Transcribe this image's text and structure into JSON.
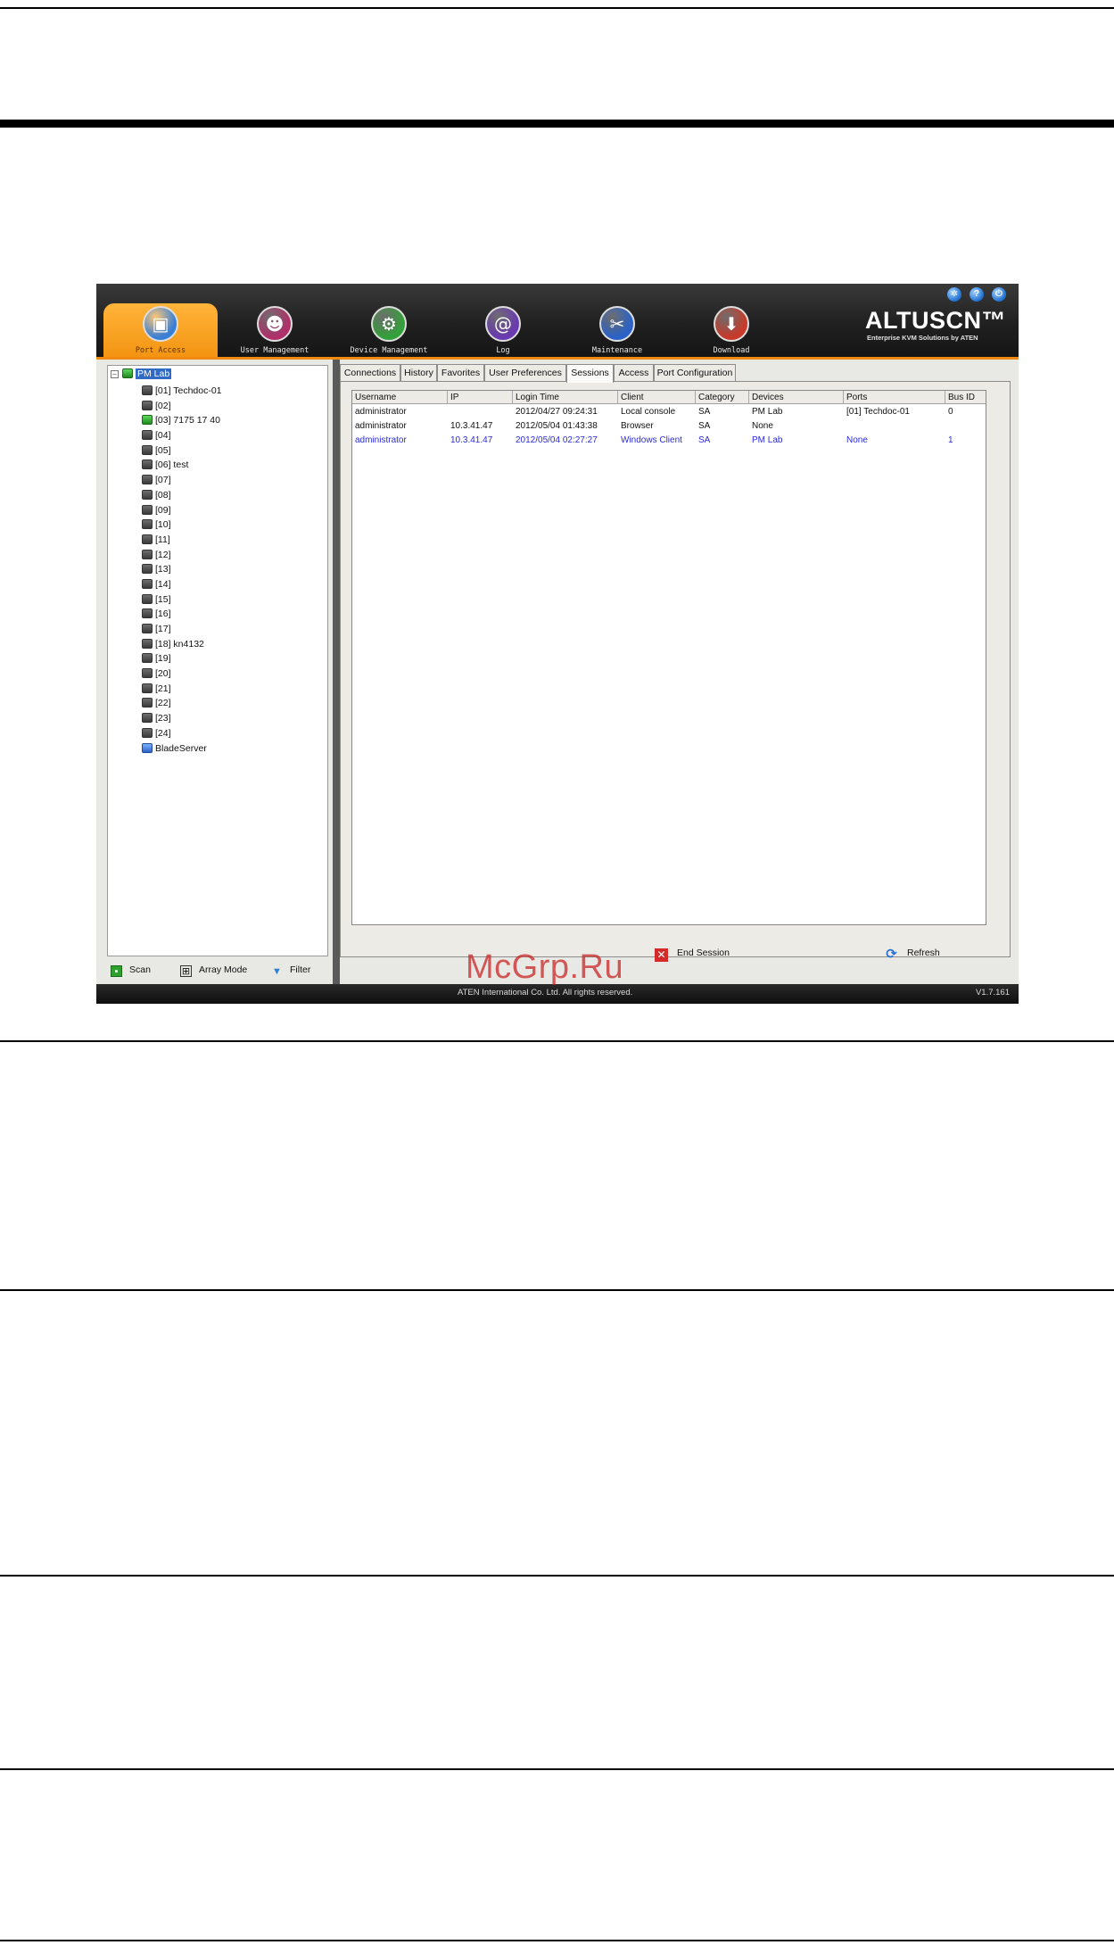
{
  "watermark": "McGrp.Ru",
  "app": {
    "window_buttons": [
      {
        "icon": "settings-icon",
        "glyph": "✲"
      },
      {
        "icon": "help-icon",
        "glyph": "?"
      },
      {
        "icon": "logout-icon",
        "glyph": "⏻"
      }
    ],
    "nav_tabs": [
      {
        "label": "Port Access",
        "icon": "port-access-icon",
        "glyph": "▣",
        "color": "#3a7fd6",
        "active": true
      },
      {
        "label": "User Management",
        "icon": "user-management-icon",
        "glyph": "☻",
        "color": "#b0306a",
        "active": false
      },
      {
        "label": "Device Management",
        "icon": "device-management-icon",
        "glyph": "⚙",
        "color": "#34a03a",
        "active": false
      },
      {
        "label": "Log",
        "icon": "log-icon",
        "glyph": "@",
        "color": "#6a3ab0",
        "active": false
      },
      {
        "label": "Maintenance",
        "icon": "maintenance-icon",
        "glyph": "✂",
        "color": "#2a62c8",
        "active": false
      },
      {
        "label": "Download",
        "icon": "download-icon",
        "glyph": "⬇",
        "color": "#c83a2a",
        "active": false
      }
    ],
    "brand": {
      "name": "ALTUSCN™",
      "tagline": "Enterprise KVM Solutions by ATEN"
    },
    "tree": {
      "root_label": "PM Lab",
      "expander": "–",
      "items": [
        {
          "label": "[01] Techdoc-01",
          "status": "offline"
        },
        {
          "label": "[02]",
          "status": "offline"
        },
        {
          "label": "[03] 7175 17 40",
          "status": "online"
        },
        {
          "label": "[04]",
          "status": "offline"
        },
        {
          "label": "[05]",
          "status": "offline"
        },
        {
          "label": "[06] test",
          "status": "offline"
        },
        {
          "label": "[07]",
          "status": "offline"
        },
        {
          "label": "[08]",
          "status": "offline"
        },
        {
          "label": "[09]",
          "status": "offline"
        },
        {
          "label": "[10]",
          "status": "offline"
        },
        {
          "label": "[11]",
          "status": "offline"
        },
        {
          "label": "[12]",
          "status": "offline"
        },
        {
          "label": "[13]",
          "status": "offline"
        },
        {
          "label": "[14]",
          "status": "offline"
        },
        {
          "label": "[15]",
          "status": "offline"
        },
        {
          "label": "[16]",
          "status": "offline"
        },
        {
          "label": "[17]",
          "status": "offline"
        },
        {
          "label": "[18] kn4132",
          "status": "offline"
        },
        {
          "label": "[19]",
          "status": "offline"
        },
        {
          "label": "[20]",
          "status": "offline"
        },
        {
          "label": "[21]",
          "status": "offline"
        },
        {
          "label": "[22]",
          "status": "offline"
        },
        {
          "label": "[23]",
          "status": "offline"
        },
        {
          "label": "[24]",
          "status": "offline"
        },
        {
          "label": "BladeServer",
          "status": "blade"
        }
      ]
    },
    "left_toolbar": {
      "scan_label": "Scan",
      "array_mode_label": "Array Mode",
      "filter_label": "Filter"
    },
    "tabs": [
      {
        "label": "Connections",
        "active": false
      },
      {
        "label": "History",
        "active": false
      },
      {
        "label": "Favorites",
        "active": false
      },
      {
        "label": "User Preferences",
        "active": false
      },
      {
        "label": "Sessions",
        "active": true
      },
      {
        "label": "Access",
        "active": false
      },
      {
        "label": "Port Configuration",
        "active": false
      }
    ],
    "sessions": {
      "columns": [
        "Username",
        "IP",
        "Login Time",
        "Client",
        "Category",
        "Devices",
        "Ports",
        "Bus ID"
      ],
      "rows": [
        {
          "cells": [
            "administrator",
            "",
            "2012/04/27 09:24:31",
            "Local console",
            "SA",
            "PM Lab",
            "[01] Techdoc-01",
            "0"
          ],
          "highlight": false
        },
        {
          "cells": [
            "administrator",
            "10.3.41.47",
            "2012/05/04 01:43:38",
            "Browser",
            "SA",
            "None",
            "",
            ""
          ],
          "highlight": false
        },
        {
          "cells": [
            "administrator",
            "10.3.41.47",
            "2012/05/04 02:27:27",
            "Windows Client",
            "SA",
            "PM Lab",
            "None",
            "1"
          ],
          "highlight": true
        }
      ]
    },
    "actions": {
      "end_session_label": "End Session",
      "refresh_label": "Refresh"
    },
    "status": {
      "copyright": "ATEN International Co. Ltd. All rights reserved.",
      "version": "V1.7.161"
    },
    "colors": {
      "accent": "#f08a10",
      "highlight_row": "#2a2ad8",
      "selection": "#316ac5"
    }
  }
}
